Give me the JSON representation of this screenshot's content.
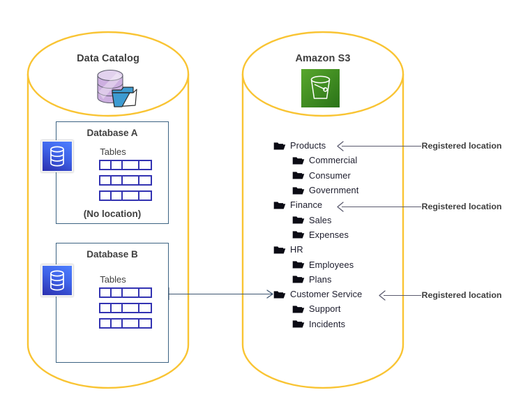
{
  "diagram": {
    "title_hidden": "",
    "colors": {
      "cylinder_stroke": "#F9C433",
      "db_box_border": "#3c6382",
      "table_blue": "#3333b2",
      "s3_green_dark": "#2E7A1E",
      "s3_green_light": "#53A52B",
      "catalog_purple": "#C9A8DC",
      "catalog_folder_blue": "#3D9BD1",
      "text_gray": "#3f3f3f",
      "connector_gray": "#5a5a6e",
      "db_arrow": "#3c5470"
    }
  },
  "left_cylinder": {
    "title": "Data Catalog",
    "icon_name": "data-catalog-icon",
    "databases": [
      {
        "title": "Database A",
        "tables_label": "Tables",
        "table_count": 3,
        "footer": "(No location)",
        "icon_name": "database-icon"
      },
      {
        "title": "Database B",
        "tables_label": "Tables",
        "table_count": 3,
        "footer": "",
        "icon_name": "database-icon"
      }
    ]
  },
  "right_cylinder": {
    "title": "Amazon S3",
    "icon_name": "s3-bucket-icon",
    "tree": [
      {
        "label": "Products",
        "level": 1,
        "registered": true
      },
      {
        "label": "Commercial",
        "level": 2,
        "registered": false
      },
      {
        "label": "Consumer",
        "level": 2,
        "registered": false
      },
      {
        "label": "Government",
        "level": 2,
        "registered": false
      },
      {
        "label": "Finance",
        "level": 1,
        "registered": true
      },
      {
        "label": "Sales",
        "level": 2,
        "registered": false
      },
      {
        "label": "Expenses",
        "level": 2,
        "registered": false
      },
      {
        "label": "HR",
        "level": 1,
        "registered": false
      },
      {
        "label": "Employees",
        "level": 2,
        "registered": false
      },
      {
        "label": "Plans",
        "level": 2,
        "registered": false
      },
      {
        "label": "Customer Service",
        "level": 1,
        "registered": true
      },
      {
        "label": "Support",
        "level": 2,
        "registered": false
      },
      {
        "label": "Incidents",
        "level": 2,
        "registered": false
      }
    ]
  },
  "annotations": {
    "registered_location_1": "Registered location",
    "registered_location_2": "Registered location",
    "registered_location_3": "Registered location"
  }
}
